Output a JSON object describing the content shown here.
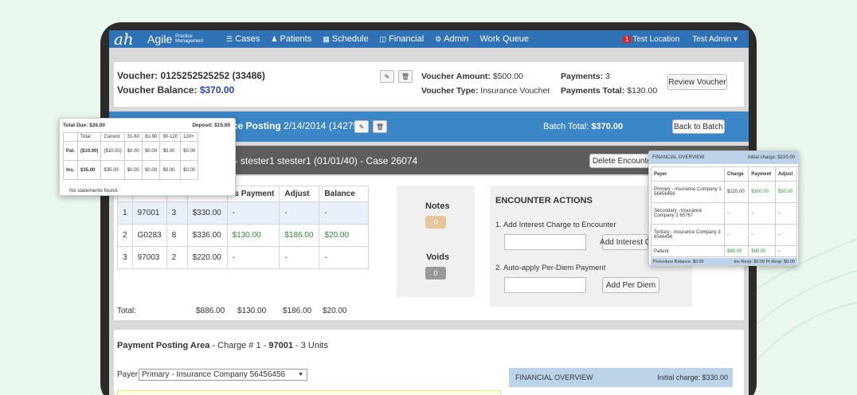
{
  "navbar": {
    "logo": "ah",
    "brand": "Agile",
    "brand_sub": "Practice Management",
    "items": [
      {
        "icon": "list-icon",
        "glyph": "☰",
        "label": "Cases"
      },
      {
        "icon": "user-icon",
        "glyph": "♟",
        "label": "Patients"
      },
      {
        "icon": "calendar-icon",
        "glyph": "▦",
        "label": "Schedule"
      },
      {
        "icon": "chart-icon",
        "glyph": "◫",
        "label": "Financial"
      },
      {
        "icon": "gears-icon",
        "glyph": "⚙",
        "label": "Admin"
      },
      {
        "icon": "",
        "glyph": "",
        "label": "Work Queue"
      }
    ],
    "location_badge": "1",
    "location": "Test Location",
    "user": "Test Admin ▾"
  },
  "voucher": {
    "title": "Voucher: 0125252525252 (33486)",
    "balance_label": "Voucher Balance:",
    "balance_value": "$370.00",
    "amount_label": "Voucher Amount:",
    "amount_value": "$500.00",
    "type_label": "Voucher Type:",
    "type_value": "Insurance Voucher",
    "payments_label": "Payments:",
    "payments_value": "3",
    "payments_total_label": "Payments Total:",
    "payments_total_value": "$130.00",
    "review_button": "Review Voucher"
  },
  "batch": {
    "title_bold": "ce Posting",
    "title_rest": "2/14/2014 (14275)",
    "total_label": "Batch Total:",
    "total_value": "$370.00",
    "back_button": "Back to Batch"
  },
  "encounter": {
    "title": "14  -  stester1 stester1 (01/01/40)  -  Case  26074",
    "delete_button": "Delete Encounter"
  },
  "charges_table": {
    "headers": [
      "",
      "",
      "",
      "",
      "is Payment",
      "Adjust",
      "Balance"
    ],
    "rows": [
      [
        "1",
        "97001",
        "3",
        "$330.00",
        "-",
        "-",
        "-"
      ],
      [
        "2",
        "G0283",
        "8",
        "$336.00",
        "$130.00",
        "$186.00",
        "$20.00"
      ],
      [
        "3",
        "97003",
        "2",
        "$220.00",
        "-",
        "-",
        "-"
      ]
    ],
    "total_label": "Total:",
    "totals": [
      "$886.00",
      "$130.00",
      "$186.00",
      "$20.00"
    ]
  },
  "notes": {
    "label": "Notes",
    "count": "0"
  },
  "voids": {
    "label": "Voids",
    "count": "0"
  },
  "encounter_actions": {
    "title": "ENCOUNTER ACTIONS",
    "item1": "1. Add Interest Charge to Encounter",
    "item1_button": "Add Interest C",
    "item2": "2. Auto-apply Per-Diem Payment",
    "item2_button": "Add Per Diem"
  },
  "payment_posting": {
    "title": "Payment Posting Area",
    "charge_label": "- Charge # 1 -",
    "code": "97001",
    "units": "- 3 Units",
    "payer_label": "Payer:",
    "payer_value": "Primary - Insurance Company 56456456",
    "financial_overview": "FINANCIAL OVERVIEW",
    "initial_charge": "Initial charge: $330.00"
  },
  "aging_popup": {
    "total_due": "Total Due: $26.00",
    "deposit": "Deposit: $15.00",
    "headers": [
      "",
      "Total",
      "Current",
      "31-60",
      "61-90",
      "90-120",
      "120+"
    ],
    "rows": [
      [
        "Pat.",
        "($10.00)",
        "($10.00)",
        "$0.00",
        "$0.00",
        "$0.00",
        "$0.00"
      ],
      [
        "Ins.",
        "$35.00",
        "$35.00",
        "$0.00",
        "$0.00",
        "$0.00",
        "$0.00"
      ]
    ],
    "footer": "No statements found."
  },
  "financial_popup": {
    "title": "FINANCIAL OVERVIEW",
    "initial": "Initial charge: $220.00",
    "headers": [
      "Payer",
      "Charge",
      "Payment",
      "Adjust"
    ],
    "rows": [
      [
        "Primary - Insurance Company 1 56456456",
        "$220.00",
        "$100.00",
        "$30.00"
      ],
      [
        "Secondary - Insurance Company 2 65767",
        "-",
        "-",
        "-"
      ],
      [
        "Tertiary - Insurance Company 3 6546456",
        "-",
        "-",
        "-"
      ],
      [
        "Patient",
        "$90.00",
        "$90.00",
        "-"
      ]
    ],
    "footer_left": "Procedure Balance: $0.00",
    "footer_right": "Ins Resp: $0.00  Pt Resp: $0.00"
  },
  "colors": {
    "navbar": "#2f72b5",
    "batchbar": "#3a86c6",
    "encbar": "#5d5d5d",
    "accent_green": "#2e8b2e",
    "balance_blue": "#2244cc"
  }
}
